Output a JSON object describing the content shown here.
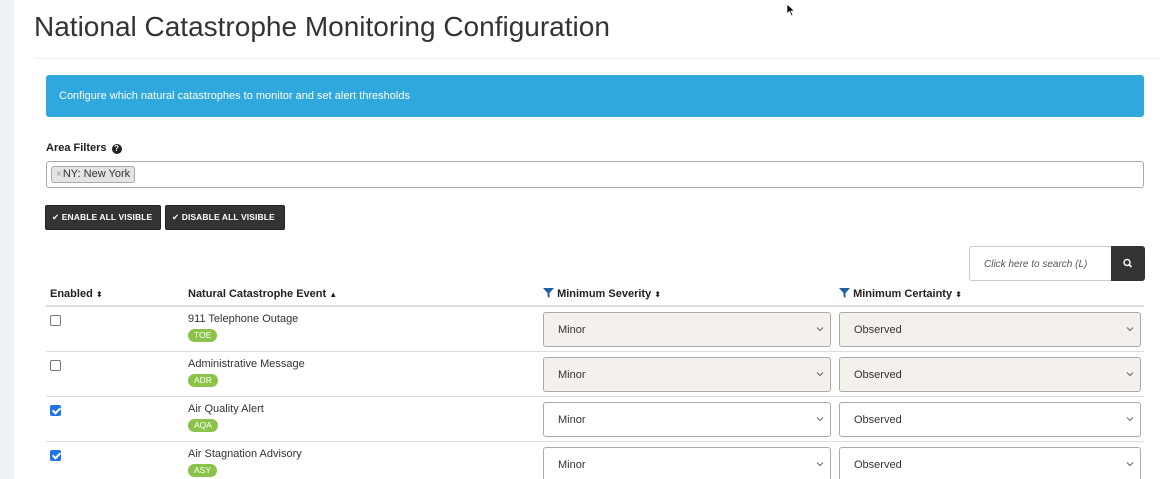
{
  "page": {
    "title": "National Catastrophe Monitoring Configuration",
    "info_banner": "Configure which natural catastrophes to monitor and set alert thresholds"
  },
  "filters": {
    "label": "Area Filters",
    "chips": [
      {
        "remove": "×",
        "label": "NY: New York"
      }
    ]
  },
  "toolbar": {
    "enable_all": "ENABLE ALL VISIBLE",
    "disable_all": "DISABLE ALL VISIBLE"
  },
  "search": {
    "placeholder": "Click here to search (L)"
  },
  "table": {
    "headers": {
      "enabled": "Enabled",
      "event": "Natural Catastrophe Event",
      "severity": "Minimum Severity",
      "certainty": "Minimum Certainty"
    },
    "rows": [
      {
        "enabled": false,
        "event": "911 Telephone Outage",
        "code": "TOE",
        "severity": "Minor",
        "certainty": "Observed"
      },
      {
        "enabled": false,
        "event": "Administrative Message",
        "code": "ADR",
        "severity": "Minor",
        "certainty": "Observed"
      },
      {
        "enabled": true,
        "event": "Air Quality Alert",
        "code": "AQA",
        "severity": "Minor",
        "certainty": "Observed"
      },
      {
        "enabled": true,
        "event": "Air Stagnation Advisory",
        "code": "ASY",
        "severity": "Minor",
        "certainty": "Observed"
      }
    ]
  },
  "colors": {
    "banner": "#2ea8dd",
    "button_dark": "#333333",
    "badge_green": "#8bc34a",
    "checkbox_checked": "#1f74e8"
  },
  "icons": {
    "help": "question-circle-icon",
    "check": "check-icon",
    "search": "search-icon",
    "filter": "filter-icon",
    "sort": "sort-icon",
    "chevron": "chevron-down-icon"
  }
}
